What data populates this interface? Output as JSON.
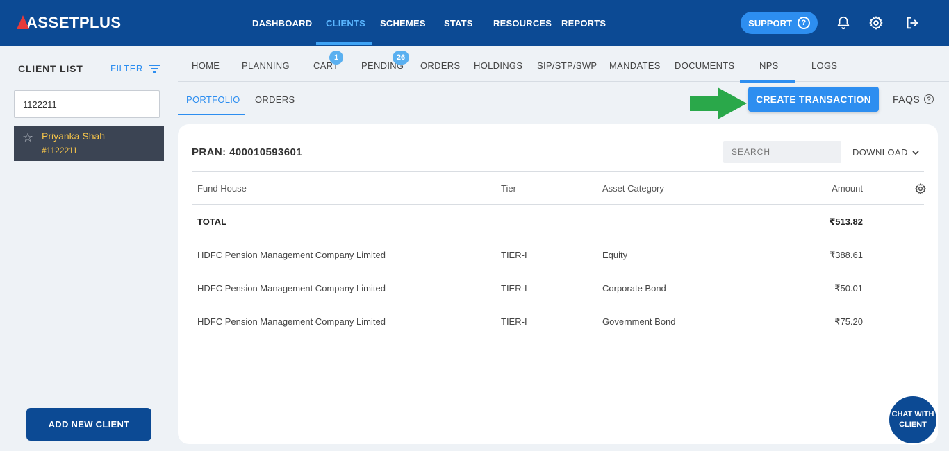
{
  "brand": {
    "name": "ASSETPLUS"
  },
  "topnav": {
    "items": [
      {
        "label": "DASHBOARD"
      },
      {
        "label": "CLIENTS"
      },
      {
        "label": "SCHEMES"
      },
      {
        "label": "STATS"
      },
      {
        "label": "RESOURCES"
      },
      {
        "label": "REPORTS"
      }
    ],
    "active": "CLIENTS",
    "support_label": "SUPPORT"
  },
  "sidebar": {
    "title": "CLIENT LIST",
    "filter_label": "FILTER",
    "search_value": "1122211",
    "client": {
      "name": "Priyanka Shah",
      "id": "#1122211"
    },
    "add_client_label": "ADD NEW CLIENT"
  },
  "subnav": {
    "items": [
      {
        "label": "HOME"
      },
      {
        "label": "PLANNING"
      },
      {
        "label": "CART",
        "badge": "1"
      },
      {
        "label": "PENDING",
        "badge": "26"
      },
      {
        "label": "ORDERS"
      },
      {
        "label": "HOLDINGS"
      },
      {
        "label": "SIP/STP/SWP"
      },
      {
        "label": "MANDATES"
      },
      {
        "label": "DOCUMENTS"
      },
      {
        "label": "NPS"
      },
      {
        "label": "LOGS"
      }
    ],
    "active": "NPS"
  },
  "nps_tabs": {
    "items": [
      {
        "label": "PORTFOLIO"
      },
      {
        "label": "ORDERS"
      }
    ],
    "active": "PORTFOLIO",
    "create_label": "CREATE TRANSACTION",
    "faqs_label": "FAQS"
  },
  "portfolio": {
    "pran_label": "PRAN:",
    "pran_value": "400010593601",
    "search_placeholder": "SEARCH",
    "download_label": "DOWNLOAD",
    "columns": [
      "Fund House",
      "Tier",
      "Asset Category",
      "Amount"
    ],
    "total": {
      "label": "TOTAL",
      "amount": "₹513.82"
    },
    "rows": [
      {
        "fund_house": "HDFC Pension Management Company Limited",
        "tier": "TIER-I",
        "category": "Equity",
        "amount": "₹388.61"
      },
      {
        "fund_house": "HDFC Pension Management Company Limited",
        "tier": "TIER-I",
        "category": "Corporate Bond",
        "amount": "₹50.01"
      },
      {
        "fund_house": "HDFC Pension Management Company Limited",
        "tier": "TIER-I",
        "category": "Government Bond",
        "amount": "₹75.20"
      }
    ]
  },
  "chat": {
    "line1": "CHAT WITH",
    "line2": "CLIENT"
  },
  "colors": {
    "primary": "#0c4a94",
    "accent": "#2d8ef0",
    "client_highlight": "#f5c44a",
    "arrow": "#2aa84a"
  },
  "icons": [
    "help-icon",
    "bell-icon",
    "settings-icon",
    "logout-icon",
    "filter-icon",
    "star-icon",
    "chevron-down-icon",
    "column-settings-icon",
    "arrow-right-icon"
  ]
}
